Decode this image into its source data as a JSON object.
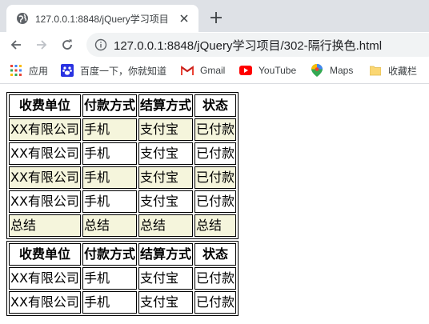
{
  "browser": {
    "tab_title": "127.0.0.1:8848/jQuery学习项目",
    "url": "127.0.0.1:8848/jQuery学习项目/302-隔行换色.html",
    "bookmarks": [
      {
        "label": "应用",
        "icon": "apps-grid-icon"
      },
      {
        "label": "百度一下，你就知道",
        "icon": "baidu-paw-icon"
      },
      {
        "label": "Gmail",
        "icon": "gmail-icon"
      },
      {
        "label": "YouTube",
        "icon": "youtube-icon"
      },
      {
        "label": "Maps",
        "icon": "maps-pin-icon"
      },
      {
        "label": "收藏栏",
        "icon": "folder-icon"
      }
    ]
  },
  "table1": {
    "headers": [
      "收费单位",
      "付款方式",
      "结算方式",
      "状态"
    ],
    "rows": [
      [
        "XX有限公司",
        "手机",
        "支付宝",
        "已付款"
      ],
      [
        "XX有限公司",
        "手机",
        "支付宝",
        "已付款"
      ],
      [
        "XX有限公司",
        "手机",
        "支付宝",
        "已付款"
      ],
      [
        "XX有限公司",
        "手机",
        "支付宝",
        "已付款"
      ],
      [
        "总结",
        "总结",
        "总结",
        "总结"
      ]
    ]
  },
  "table2": {
    "headers": [
      "收费单位",
      "付款方式",
      "结算方式",
      "状态"
    ],
    "rows": [
      [
        "XX有限公司",
        "手机",
        "支付宝",
        "已付款"
      ],
      [
        "XX有限公司",
        "手机",
        "支付宝",
        "已付款"
      ]
    ]
  },
  "colors": {
    "stripe": "#f5f5dc",
    "tabstrip": "#dee1e6"
  }
}
